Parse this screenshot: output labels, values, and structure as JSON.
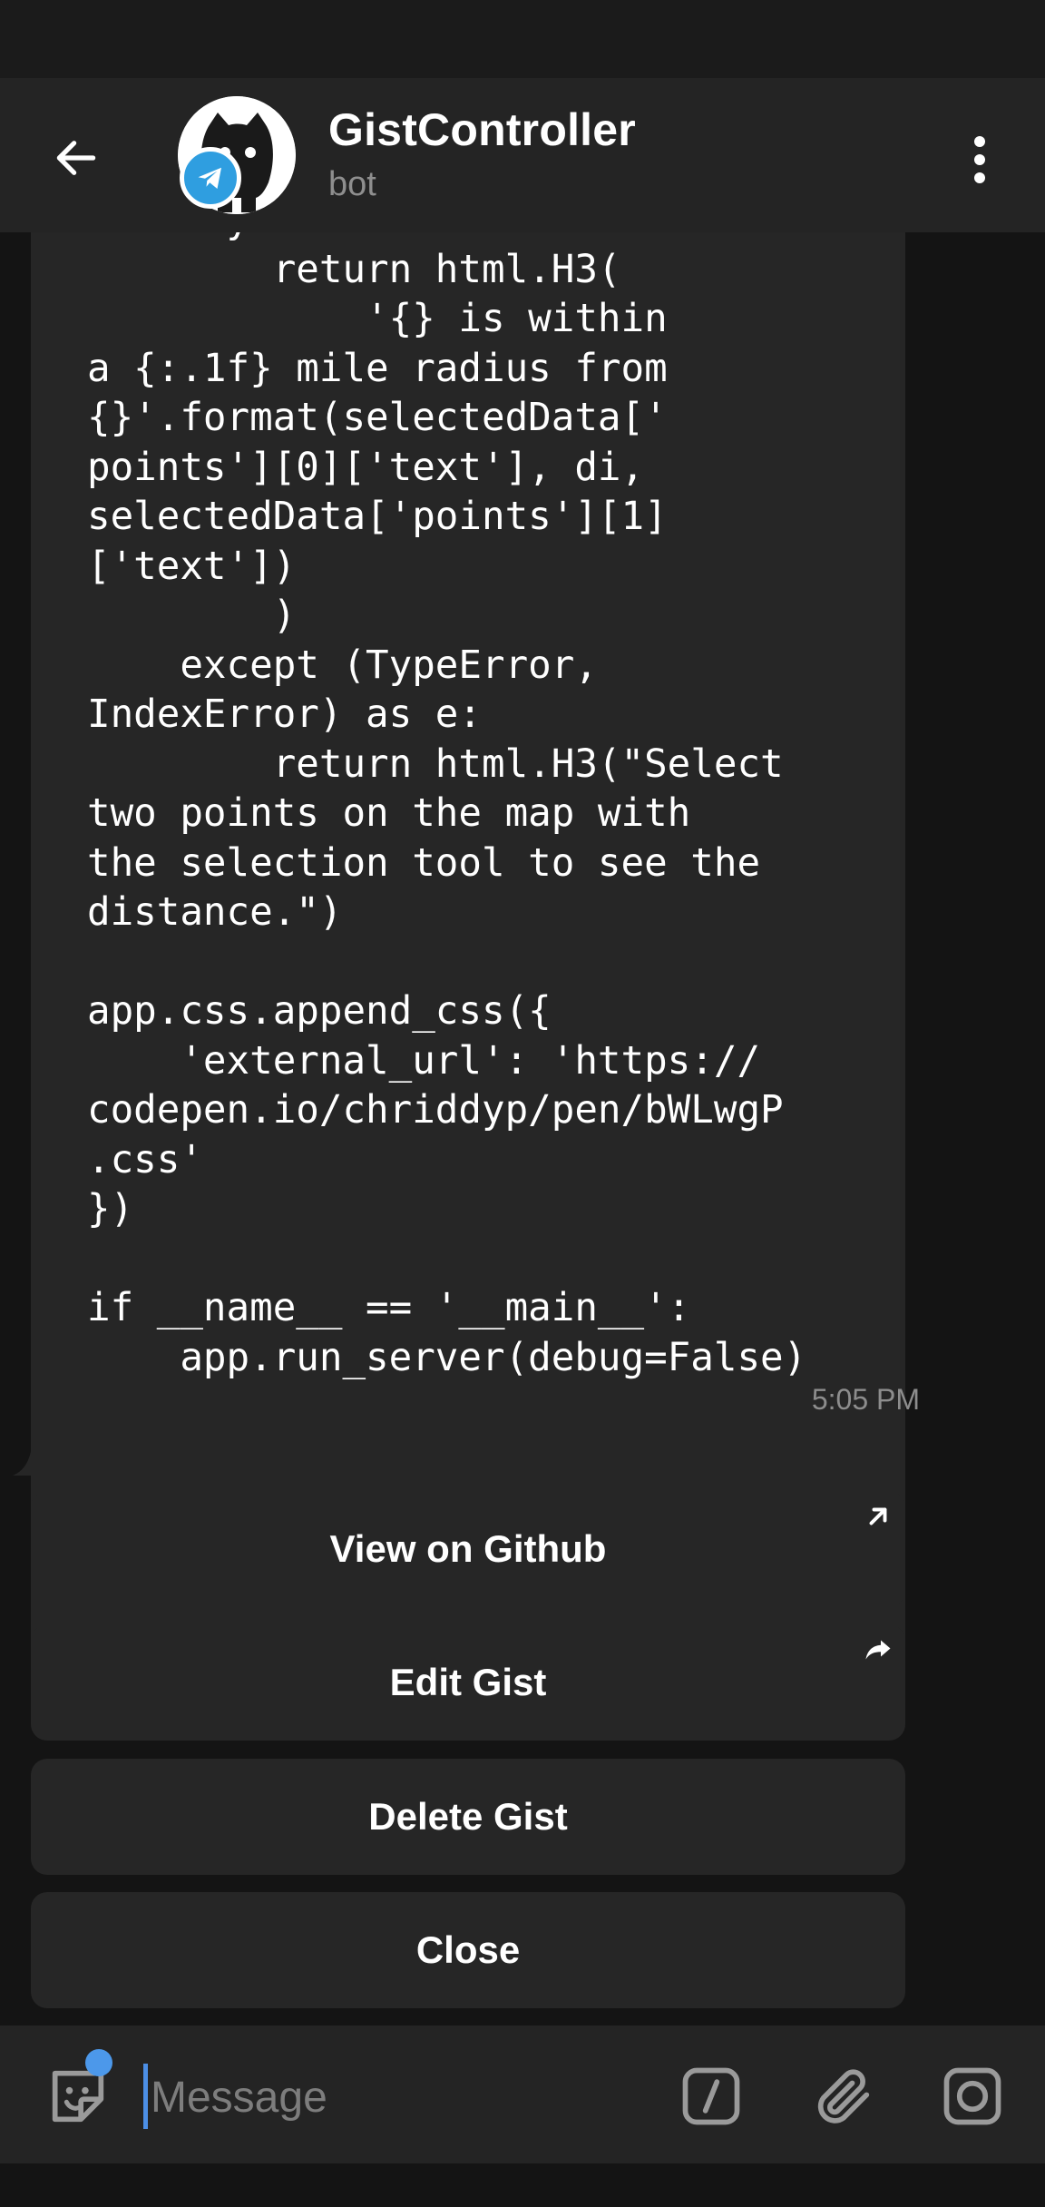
{
  "header": {
    "title": "GistController",
    "subtitle": "bot"
  },
  "message": {
    "code_lines": [
      "    try:",
      "        return html.H3(",
      "            '{} is within",
      "a {:.1f} mile radius from",
      "{}'.format(selectedData['",
      "points'][0]['text'], di,",
      "selectedData['points'][1]",
      "['text'])",
      "        )",
      "    except (TypeError,",
      "IndexError) as e:",
      "        return html.H3(\"Select",
      "two points on the map with",
      "the selection tool to see the",
      "distance.\")",
      "",
      "app.css.append_css({",
      "    'external_url': 'https://",
      "codepen.io/chriddyp/pen/bWLwgP",
      ".css'",
      "})",
      "",
      "if __name__ == '__main__':",
      "    app.run_server(debug=False)"
    ],
    "time": "5:05 PM"
  },
  "keyboard": {
    "view_on_github": "View on Github",
    "edit_gist": "Edit Gist",
    "delete_gist": "Delete Gist",
    "close": "Close"
  },
  "composer": {
    "placeholder": "Message"
  },
  "icons": {
    "back": "arrow-left-icon",
    "menu": "more-vertical-icon",
    "sticker": "sticker-icon",
    "command": "slash-command-icon",
    "attach": "paperclip-icon",
    "camera": "camera-icon",
    "link": "external-link-icon",
    "share": "share-arrow-icon"
  },
  "colors": {
    "accent": "#4c98ea",
    "telegram_badge": "#2f9ee0"
  }
}
